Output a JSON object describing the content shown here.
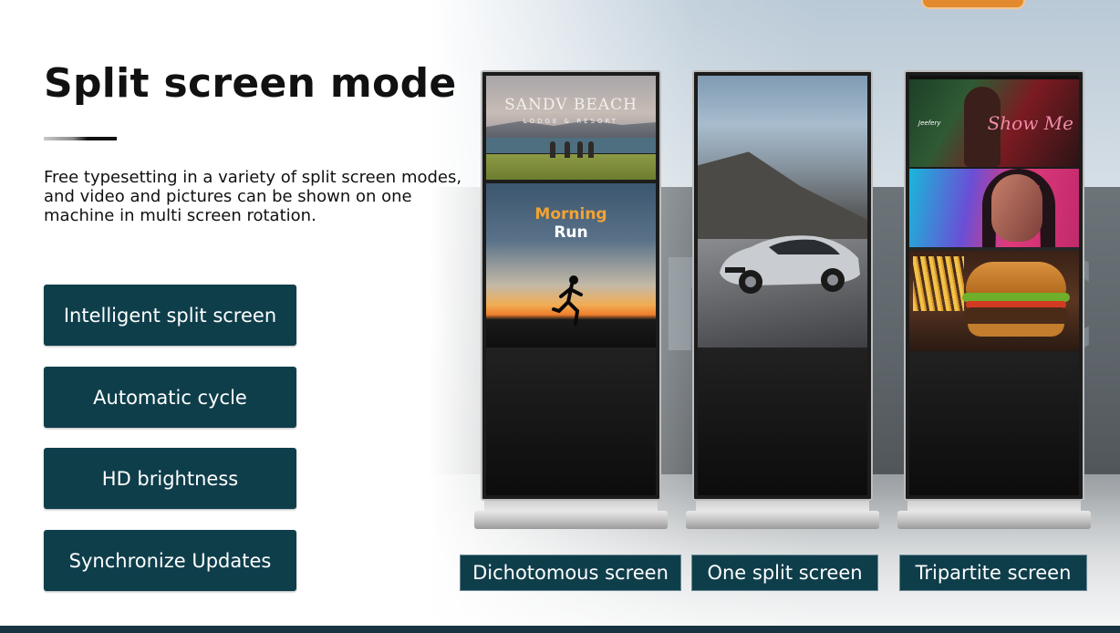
{
  "title": "Split screen mode",
  "description": "Free typesetting in a variety of split screen modes, and video and pictures can be shown on one machine in multi screen rotation.",
  "features": [
    {
      "label": "Intelligent split screen"
    },
    {
      "label": "Automatic cycle"
    },
    {
      "label": "HD brightness"
    },
    {
      "label": "Synchronize Updates"
    }
  ],
  "screens": {
    "dichotomous": {
      "label": "Dichotomous screen",
      "top_pane_title": "SANDV BEACH",
      "top_pane_subtitle": "LODGE & RESORT",
      "bottom_pane_line1": "Morning",
      "bottom_pane_line2": "Run"
    },
    "one_split": {
      "label": "One split screen"
    },
    "tripartite": {
      "label": "Tripartite screen",
      "pane1_text": "Show Me",
      "pane1_logo": "Jeefery"
    }
  },
  "colors": {
    "accent": "#0f3e4b",
    "morning_orange": "#f3a332",
    "title_text": "#111111"
  }
}
